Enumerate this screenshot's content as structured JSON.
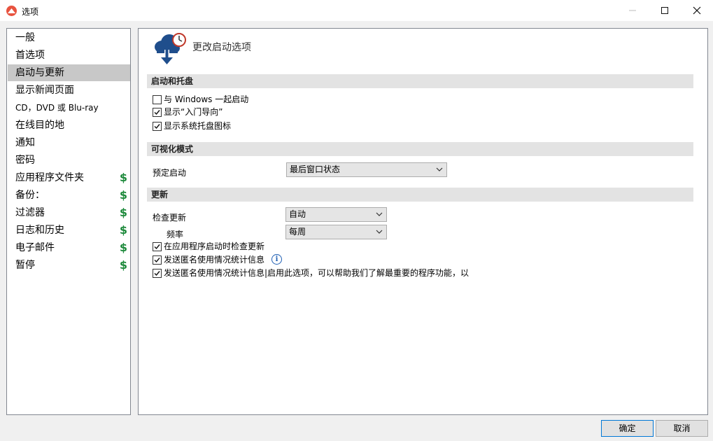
{
  "window": {
    "title": "选项"
  },
  "nav": {
    "items": [
      {
        "label": "一般",
        "paid": false
      },
      {
        "label": "首选项",
        "paid": false
      },
      {
        "label": "启动与更新",
        "paid": false,
        "selected": true
      },
      {
        "label": "显示新闻页面",
        "paid": false
      },
      {
        "label": "CD，DVD 或 Blu-ray",
        "paid": false
      },
      {
        "label": "在线目的地",
        "paid": false
      },
      {
        "label": "通知",
        "paid": false
      },
      {
        "label": "密码",
        "paid": false
      },
      {
        "label": "应用程序文件夹",
        "paid": true
      },
      {
        "label": "备份：",
        "paid": true
      },
      {
        "label": "过滤器",
        "paid": true
      },
      {
        "label": "日志和历史",
        "paid": true
      },
      {
        "label": "电子邮件",
        "paid": true
      },
      {
        "label": "暂停",
        "paid": true
      }
    ],
    "paid_symbol": "$",
    "paid_color": "#1e8a3c"
  },
  "panel": {
    "header_title": "更改启动选项",
    "startup_section": {
      "title": "启动和托盘",
      "options": [
        {
          "label": "与 Windows 一起启动",
          "checked": false
        },
        {
          "label": "显示“入门导向”",
          "checked": true
        },
        {
          "label": "显示系统托盘图标",
          "checked": true
        }
      ]
    },
    "visual_section": {
      "title": "可视化模式",
      "default_start_label": "预定启动",
      "default_start_value": "最后窗口状态"
    },
    "update_section": {
      "title": "更新",
      "check_label": "检查更新",
      "check_value": "自动",
      "frequency_label": "频率",
      "frequency_value": "每周",
      "options": [
        {
          "label": "在应用程序启动时检查更新",
          "checked": true
        },
        {
          "label": "发送匿名使用情况统计信息",
          "checked": true
        },
        {
          "label": "发送匿名使用情况统计信息|启用此选项，可以帮助我们了解最重要的程序功能，以",
          "checked": true
        }
      ],
      "info_glyph": "i"
    }
  },
  "buttons": {
    "ok": "确定",
    "cancel": "取消"
  }
}
